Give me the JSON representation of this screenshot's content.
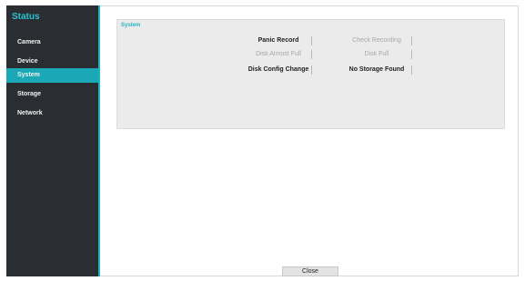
{
  "sidebar": {
    "title": "Status",
    "items": [
      {
        "label": "Camera"
      },
      {
        "label": "Device"
      },
      {
        "label": "System"
      },
      {
        "label": "Storage"
      },
      {
        "label": "Network"
      }
    ],
    "active": "System"
  },
  "panel": {
    "title": "System",
    "rows": [
      [
        {
          "label": "Panic Record",
          "state": "on"
        },
        {
          "label": "Check Recording",
          "state": "off"
        }
      ],
      [
        {
          "label": "Disk Almost Full",
          "state": "off"
        },
        {
          "label": "Disk Full",
          "state": "off"
        }
      ],
      [
        {
          "label": "Disk Config Change",
          "state": "on"
        },
        {
          "label": "No Storage Found",
          "state": "on"
        }
      ]
    ]
  },
  "footer": {
    "close_label": "Close"
  },
  "colors": {
    "accent": "#1aa8b6",
    "sidebar_bg": "#2a2d31",
    "panel_bg": "#ebebeb"
  }
}
